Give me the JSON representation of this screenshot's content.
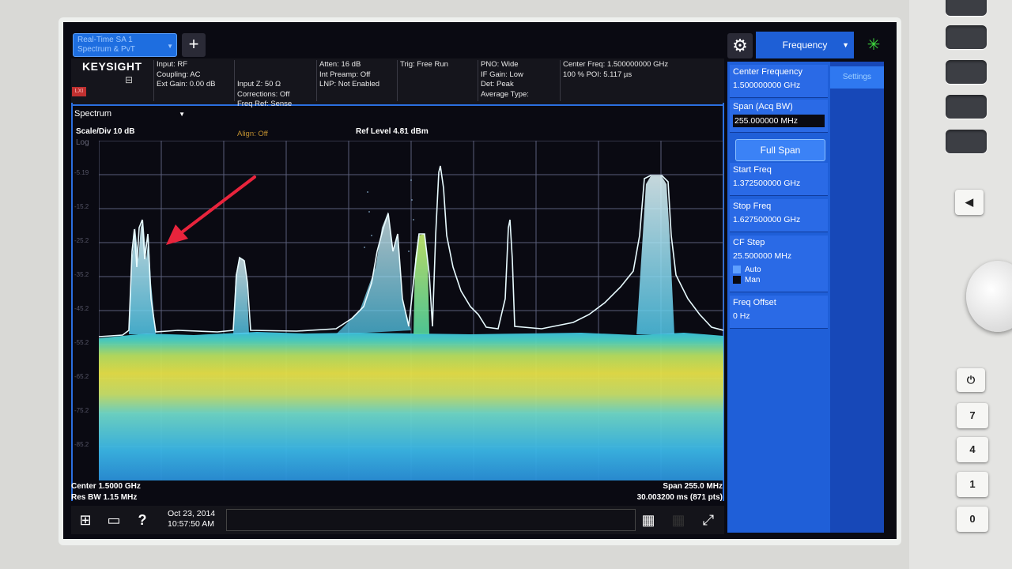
{
  "tab": {
    "line1": "Real-Time SA 1",
    "line2": "Spectrum & PvT"
  },
  "brand": "KEYSIGHT",
  "lxi": "LXI",
  "infobar": {
    "col1": "Input: RF\nCoupling: AC\nExt Gain: 0.00 dB",
    "col2a": "Input Z: 50 Ω\nCorrections: Off\nFreq Ref: Sense",
    "col2b": "Align: Off",
    "col3": "Atten: 16 dB\nInt Preamp: Off\nLNP: Not Enabled",
    "col4": "Trig: Free Run",
    "col5": "PNO: Wide\nIF Gain: Low\nDet: Peak\nAverage Type:",
    "col6": "Center Freq: 1.500000000 GHz\n100 % POI: 5.117 µs"
  },
  "menu": {
    "title": "Frequency",
    "settings_tab": "Settings"
  },
  "softkeys": {
    "center_freq": {
      "label": "Center Frequency",
      "value": "1.500000000 GHz"
    },
    "span": {
      "label": "Span (Acq BW)",
      "value": "255.000000 MHz"
    },
    "full_span": "Full Span",
    "start_freq": {
      "label": "Start Freq",
      "value": "1.372500000 GHz"
    },
    "stop_freq": {
      "label": "Stop Freq",
      "value": "1.627500000 GHz"
    },
    "cf_step": {
      "label": "CF Step",
      "value": "25.500000 MHz",
      "auto": "Auto",
      "man": "Man"
    },
    "freq_offset": {
      "label": "Freq Offset",
      "value": "0 Hz"
    }
  },
  "window": {
    "title": "Spectrum"
  },
  "plot": {
    "scale": "Scale/Div 10 dB",
    "log": "Log",
    "ref_level": "Ref Level 4.81 dBm",
    "y_ticks": [
      "-5.19",
      "-15.2",
      "-25.2",
      "-35.2",
      "-45.2",
      "-55.2",
      "-65.2",
      "-75.2",
      "-85.2"
    ],
    "center": "Center 1.5000 GHz",
    "res_bw": "Res BW 1.15 MHz",
    "span": "Span 255.0 MHz",
    "sweep": "30.003200 ms (871 pts)"
  },
  "taskbar": {
    "date": "Oct 23, 2014",
    "time": "10:57:50 AM"
  },
  "hardware_keys": {
    "numbers": [
      "7",
      "4",
      "1",
      "0"
    ]
  },
  "colors": {
    "accent": "#1f5fd8",
    "annotation_arrow": "#e8243c",
    "trace": "#dff6ff"
  }
}
